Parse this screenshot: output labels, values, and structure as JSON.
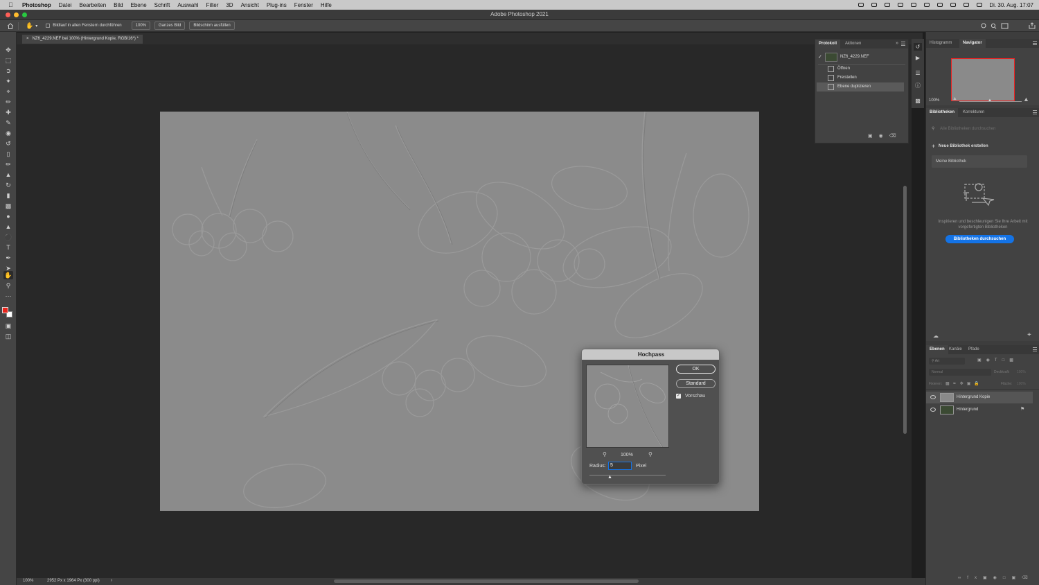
{
  "os_menubar": {
    "app": "Photoshop",
    "menus": [
      "Datei",
      "Bearbeiten",
      "Bild",
      "Ebene",
      "Schrift",
      "Auswahl",
      "Filter",
      "3D",
      "Ansicht",
      "Plug-ins",
      "Fenster",
      "Hilfe"
    ],
    "clock": "Di. 30. Aug.  17:07"
  },
  "window": {
    "title": "Adobe Photoshop 2021"
  },
  "options_bar": {
    "scroll_all_label": "Bildlauf in allen Fenstern durchführen",
    "zoom_value": "100%",
    "fit_screen_label": "Ganzes Bild",
    "fill_screen_label": "Bildschirm ausfüllen"
  },
  "document": {
    "tab_title": "NZ6_4229.NEF bei 100% (Hintergrund Kopie, RGB/16*) *"
  },
  "status_bar": {
    "zoom": "100%",
    "doc_size": "2952 Px x 1964 Px (300 ppi)"
  },
  "history_panel": {
    "tabs": [
      "Protokoll",
      "Aktionen"
    ],
    "snapshot": "NZ6_4229.NEF",
    "steps": [
      "Öffnen",
      "Freistellen",
      "Ebene duplizieren"
    ]
  },
  "navigator_panel": {
    "tabs": [
      "Histogramm",
      "Navigator"
    ],
    "zoom": "100%"
  },
  "libraries_panel": {
    "tabs": [
      "Bibliotheken",
      "Korrekturen"
    ],
    "search_placeholder": "Alle Bibliotheken durchsuchen",
    "new_library": "Neue Bibliothek erstellen",
    "library_name": "Meine Bibliothek",
    "info_text": "Inspirieren und beschleunigen Sie Ihre Arbeit mit vorgefertigten Bibliotheken",
    "browse_button": "Bibliotheken durchsuchen"
  },
  "layers_panel": {
    "tabs": [
      "Ebenen",
      "Kanäle",
      "Pfade"
    ],
    "filter_placeholder": "Art",
    "blend_mode": "Normal",
    "opacity_label": "Deckkraft:",
    "opacity_value": "100%",
    "lock_label": "Fixieren:",
    "fill_label": "Fläche:",
    "fill_value": "100%",
    "layers": [
      {
        "name": "Hintergrund Kopie",
        "selected": true
      },
      {
        "name": "Hintergrund",
        "locked": true
      }
    ]
  },
  "dialog": {
    "title": "Hochpass",
    "ok_label": "OK",
    "reset_label": "Standard",
    "preview_label": "Vorschau",
    "preview_checked": true,
    "preview_zoom": "100%",
    "radius_label": "Radius:",
    "radius_value": "5",
    "radius_unit": "Pixel"
  },
  "colors": {
    "foreground": "#e8251c",
    "background": "#ffffff",
    "accent_button": "#1473e6",
    "highpass_gray": "#8a8a8a"
  }
}
